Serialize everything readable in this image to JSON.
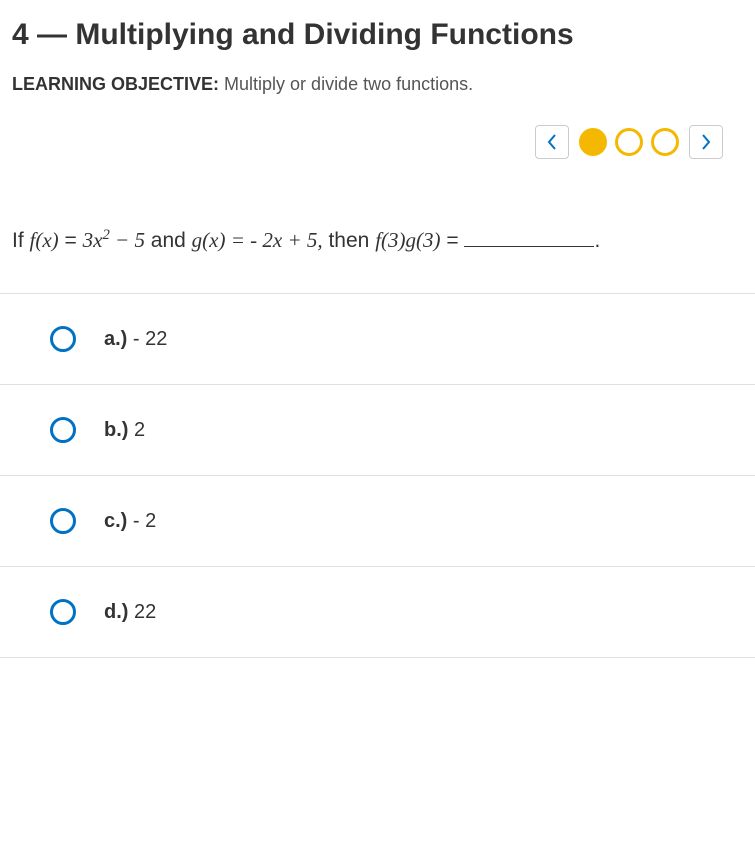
{
  "header": {
    "title": "4 — Multiplying and Dividing Functions",
    "objective_label": "LEARNING OBJECTIVE:",
    "objective_text": " Multiply or divide two functions."
  },
  "nav": {
    "dots": [
      true,
      false,
      false
    ]
  },
  "question": {
    "prefix": "If ",
    "fx_lhs": "f(x)",
    "eq": " = ",
    "fx_rhs_a": "3x",
    "fx_exp": "2",
    "fx_rhs_b": " − 5",
    "and": " and ",
    "gx_lhs": "g(x)",
    "gx_rhs": " =  - 2x + 5,",
    "then": " then ",
    "expr": "f(3)g(3)",
    "tail": " = ",
    "period": "."
  },
  "choices": [
    {
      "letter": "a.)",
      "text": " - 22"
    },
    {
      "letter": "b.)",
      "text": " 2"
    },
    {
      "letter": "c.)",
      "text": " - 2"
    },
    {
      "letter": "d.)",
      "text": " 22"
    }
  ]
}
